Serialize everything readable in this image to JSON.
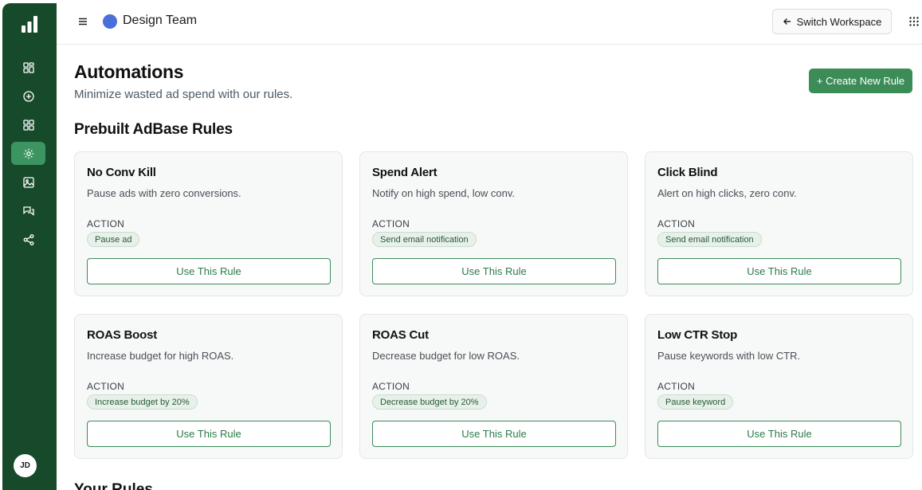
{
  "sidebar": {
    "logo": "bar-chart-logo",
    "items": [
      {
        "icon": "dashboard-icon"
      },
      {
        "icon": "plus-circle-icon"
      },
      {
        "icon": "grid-icon"
      },
      {
        "icon": "gear-icon",
        "active": true
      },
      {
        "icon": "image-icon"
      },
      {
        "icon": "chat-icon"
      },
      {
        "icon": "share-icon"
      }
    ],
    "avatar": "JD"
  },
  "header": {
    "team_name": "Design Team",
    "switch_label": "Switch Workspace"
  },
  "main": {
    "title": "Automations",
    "subtitle": "Minimize wasted ad spend with our rules.",
    "create_label": "+ Create New Rule",
    "section_title": "Prebuilt AdBase Rules",
    "next_section_title": "Your Rules"
  },
  "cards": [
    {
      "title": "No Conv Kill",
      "desc": "Pause ads with zero conversions.",
      "action_label": "ACTION",
      "badge": "Pause ad",
      "button": "Use This Rule"
    },
    {
      "title": "Spend Alert",
      "desc": "Notify on high spend, low conv.",
      "action_label": "ACTION",
      "badge": "Send email notification",
      "button": "Use This Rule"
    },
    {
      "title": "Click Blind",
      "desc": "Alert on high clicks, zero conv.",
      "action_label": "ACTION",
      "badge": "Send email notification",
      "button": "Use This Rule"
    },
    {
      "title": "ROAS Boost",
      "desc": "Increase budget for high ROAS.",
      "action_label": "ACTION",
      "badge": "Increase budget by 20%",
      "button": "Use This Rule"
    },
    {
      "title": "ROAS Cut",
      "desc": "Decrease budget for low ROAS.",
      "action_label": "ACTION",
      "badge": "Decrease budget by 20%",
      "button": "Use This Rule"
    },
    {
      "title": "Low CTR Stop",
      "desc": "Pause keywords with low CTR.",
      "action_label": "ACTION",
      "badge": "Pause keyword",
      "button": "Use This Rule"
    }
  ],
  "colors": {
    "sidebar": "#174a2a",
    "accent": "#3c8c58",
    "active_nav": "#3c9560",
    "team_dot": "#4a6fd8"
  }
}
